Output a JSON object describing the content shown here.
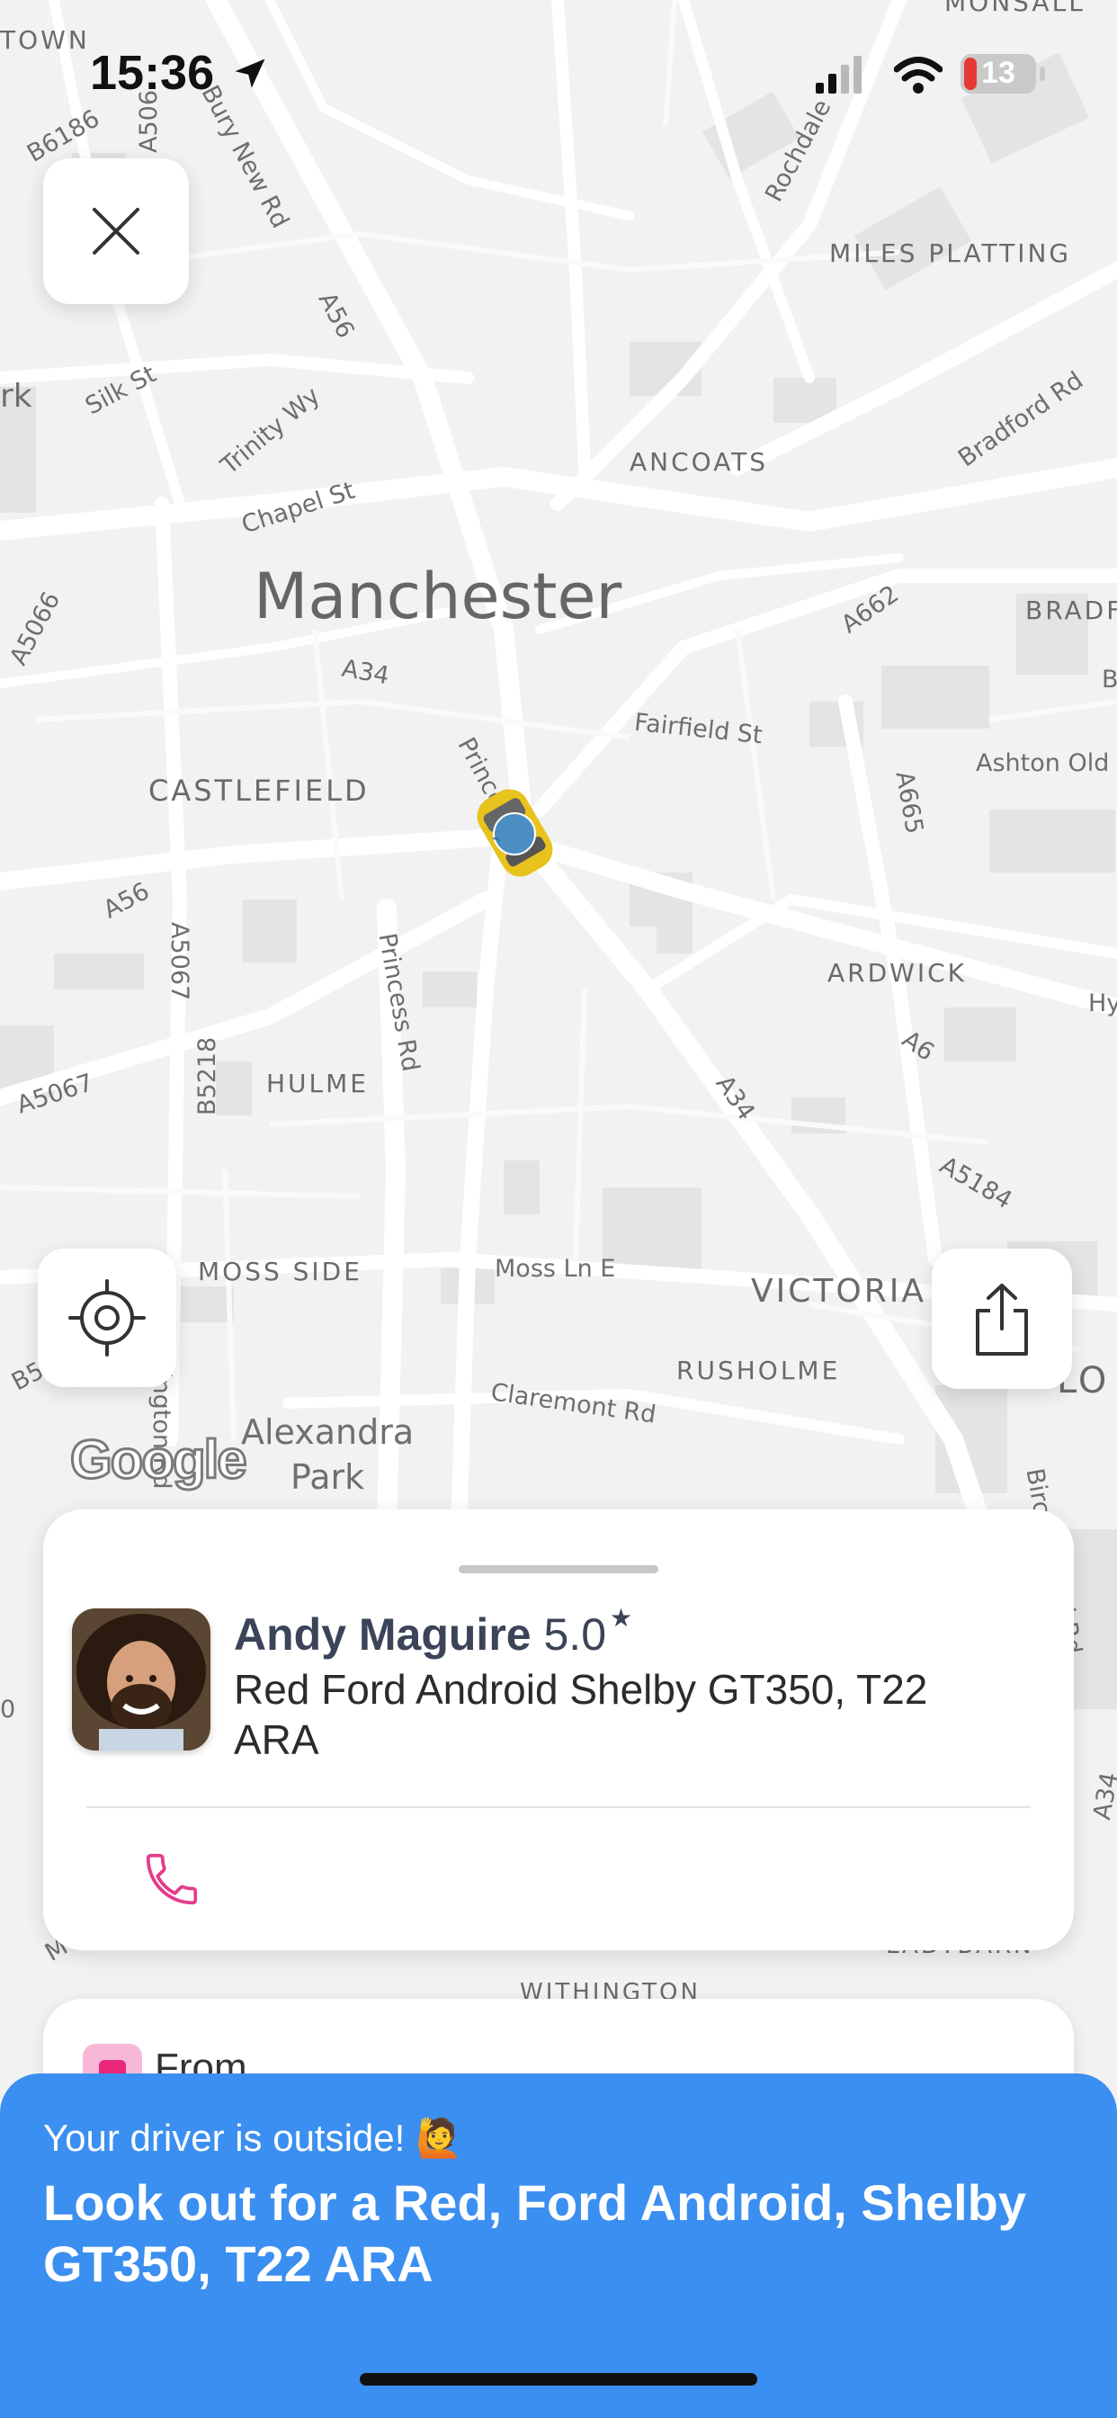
{
  "status_bar": {
    "time": "15:36",
    "battery": "13"
  },
  "map": {
    "city_label": "Manchester",
    "districts": [
      "MILES PLATTING",
      "ANCOATS",
      "CASTLEFIELD",
      "ARDWICK",
      "HULME",
      "MOSS SIDE",
      "VICTORIA",
      "RUSHOLME",
      "WITHINGTON",
      "BRADF",
      "TOWN",
      "MONSALL",
      "LADYBARN",
      "LO"
    ],
    "roads": [
      "Bury New Rd",
      "Rochdale",
      "A56",
      "Silk St",
      "Trinity Wy",
      "Chapel St",
      "Bradford Rd",
      "A662",
      "A34",
      "Princess St",
      "Fairfield St",
      "A665",
      "Ashton Old",
      "A56",
      "A5067",
      "Princess Rd",
      "A6",
      "A34",
      "A5184",
      "A5067",
      "B5218",
      "Moss Ln E",
      "Claremont Rd",
      "A5066",
      "B6186",
      "A506",
      "Birc",
      "A34",
      "Hy",
      "rk",
      "B5",
      "ington Rd",
      "0",
      "M",
      "Jld Rd",
      "B"
    ],
    "park_label": [
      "Alexandra",
      "Park"
    ],
    "attribution": "Google"
  },
  "driver": {
    "name": "Andy Maguire",
    "rating": "5.0",
    "star": "★",
    "vehicle": "Red Ford Android Shelby GT350, T22 ARA"
  },
  "from_card": {
    "label": "From"
  },
  "banner": {
    "subtitle": "Your driver is outside! 🙋",
    "message": "Look out for a Red, Ford Android, Shelby GT350, T22 ARA"
  },
  "colors": {
    "banner_bg": "#3b8ff0",
    "phone_icon": "#e43b8e",
    "from_icon": "#e8277a",
    "battery_low": "#e53935",
    "car": "#e8c21d",
    "driver_text": "#3b4458"
  },
  "icons": {
    "close": "close-icon",
    "locate": "crosshair-icon",
    "share": "share-icon",
    "phone": "phone-icon",
    "car": "car-icon"
  }
}
